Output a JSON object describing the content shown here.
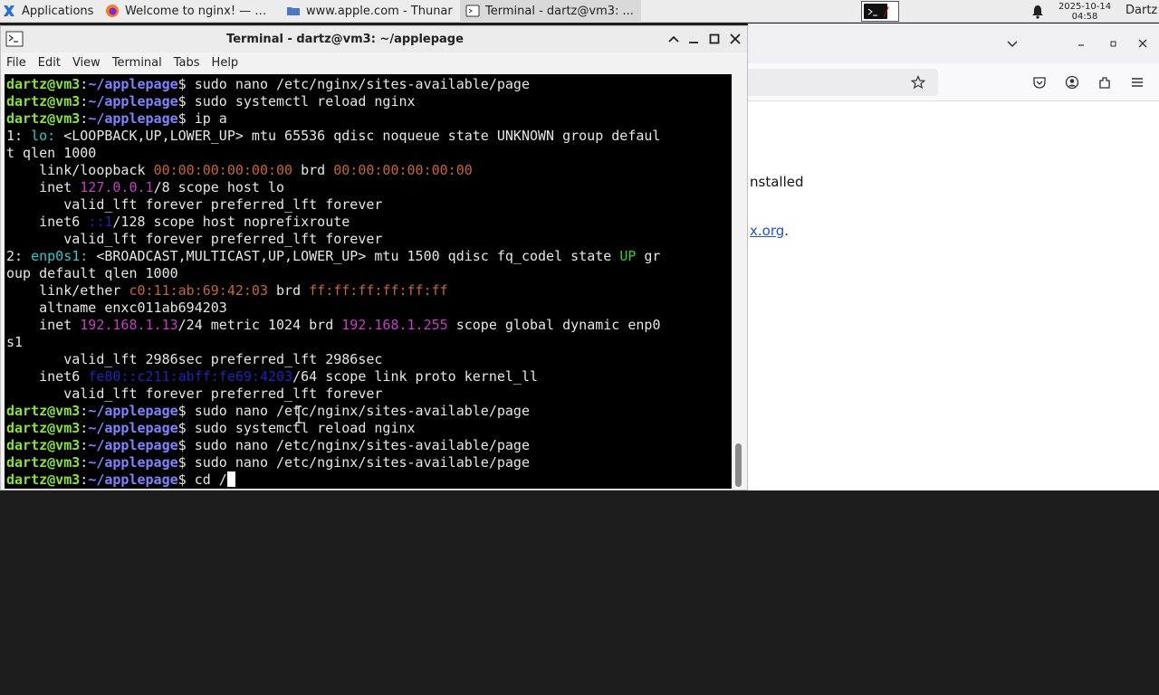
{
  "panel": {
    "applications": "Applications",
    "tasks": [
      {
        "label": "Welcome to nginx! — M..."
      },
      {
        "label": "www.apple.com - Thunar"
      },
      {
        "label": "Terminal - dartz@vm3: ..."
      }
    ],
    "clock_date": "2025-10-14",
    "clock_time": "04:58",
    "user": "Dartz"
  },
  "browser": {
    "text_installed": "nstalled",
    "link_text": "x.org",
    "link_suffix": "."
  },
  "terminal": {
    "title": "Terminal - dartz@vm3: ~/applepage",
    "menu": [
      "File",
      "Edit",
      "View",
      "Terminal",
      "Tabs",
      "Help"
    ],
    "prompt_user": "dartz@vm3",
    "prompt_sep": ":",
    "prompt_path": "~/applepage",
    "prompt_dollar": "$ ",
    "lines": [
      [
        {
          "c": "P"
        },
        {
          "t": "sudo nano /etc/nginx/sites-available/page"
        }
      ],
      [
        {
          "c": "P"
        },
        {
          "t": "sudo systemctl reload nginx"
        }
      ],
      [
        {
          "c": "P"
        },
        {
          "t": "ip a"
        }
      ],
      [
        {
          "t": "1: "
        },
        {
          "t": "lo:",
          "s": "cy"
        },
        {
          "t": " <LOOPBACK,UP,LOWER_UP> mtu 65536 qdisc noqueue state UNKNOWN group defaul"
        }
      ],
      [
        {
          "t": "t qlen 1000"
        }
      ],
      [
        {
          "t": "    link/loopback "
        },
        {
          "t": "00:00:00:00:00:00",
          "s": "or"
        },
        {
          "t": " brd "
        },
        {
          "t": "00:00:00:00:00:00",
          "s": "or"
        }
      ],
      [
        {
          "t": "    inet "
        },
        {
          "t": "127.0.0.1",
          "s": "mg"
        },
        {
          "t": "/8 scope host lo"
        }
      ],
      [
        {
          "t": "       valid_lft forever preferred_lft forever"
        }
      ],
      [
        {
          "t": "    inet6 "
        },
        {
          "t": "::1",
          "s": "bl"
        },
        {
          "t": "/128 scope host noprefixroute"
        }
      ],
      [
        {
          "t": "       valid_lft forever preferred_lft forever"
        }
      ],
      [
        {
          "t": "2: "
        },
        {
          "t": "enp0s1:",
          "s": "cy"
        },
        {
          "t": " <BROADCAST,MULTICAST,UP,LOWER_UP> mtu 1500 qdisc fq_codel state "
        },
        {
          "t": "UP",
          "s": "gr"
        },
        {
          "t": " gr"
        }
      ],
      [
        {
          "t": "oup default qlen 1000"
        }
      ],
      [
        {
          "t": "    link/ether "
        },
        {
          "t": "c0:11:ab:69:42:03",
          "s": "or"
        },
        {
          "t": " brd "
        },
        {
          "t": "ff:ff:ff:ff:ff:ff",
          "s": "or"
        }
      ],
      [
        {
          "t": "    altname enxc011ab694203"
        }
      ],
      [
        {
          "t": "    inet "
        },
        {
          "t": "192.168.1.13",
          "s": "mg"
        },
        {
          "t": "/24 metric 1024 brd "
        },
        {
          "t": "192.168.1.255",
          "s": "mg"
        },
        {
          "t": " scope global dynamic enp0"
        }
      ],
      [
        {
          "t": "s1"
        }
      ],
      [
        {
          "t": "       valid_lft 2986sec preferred_lft 2986sec"
        }
      ],
      [
        {
          "t": "    inet6 "
        },
        {
          "t": "fe80::c211:abff:fe69:4203",
          "s": "bl"
        },
        {
          "t": "/64 scope link proto kernel_ll"
        }
      ],
      [
        {
          "t": "       valid_lft forever preferred_lft forever"
        }
      ],
      [
        {
          "c": "P"
        },
        {
          "t": "sudo nano /etc/nginx/sites-available/page"
        }
      ],
      [
        {
          "c": "P"
        },
        {
          "t": "sudo systemctl reload nginx"
        }
      ],
      [
        {
          "c": "P"
        },
        {
          "t": "sudo nano /etc/nginx/sites-available/page"
        }
      ],
      [
        {
          "c": "P"
        },
        {
          "t": "sudo nano /etc/nginx/sites-available/page"
        }
      ],
      [
        {
          "c": "P"
        },
        {
          "t": "cd /"
        },
        {
          "c": "CURSOR"
        }
      ]
    ]
  },
  "colors": {
    "prompt_user": "#8ae234",
    "prompt_path": "#7f83ff",
    "interface": "#34c7c7",
    "ip": "#c33fc3",
    "mac": "#c4663a",
    "state_up": "#33cc33",
    "ipv6": "#2323b8"
  }
}
